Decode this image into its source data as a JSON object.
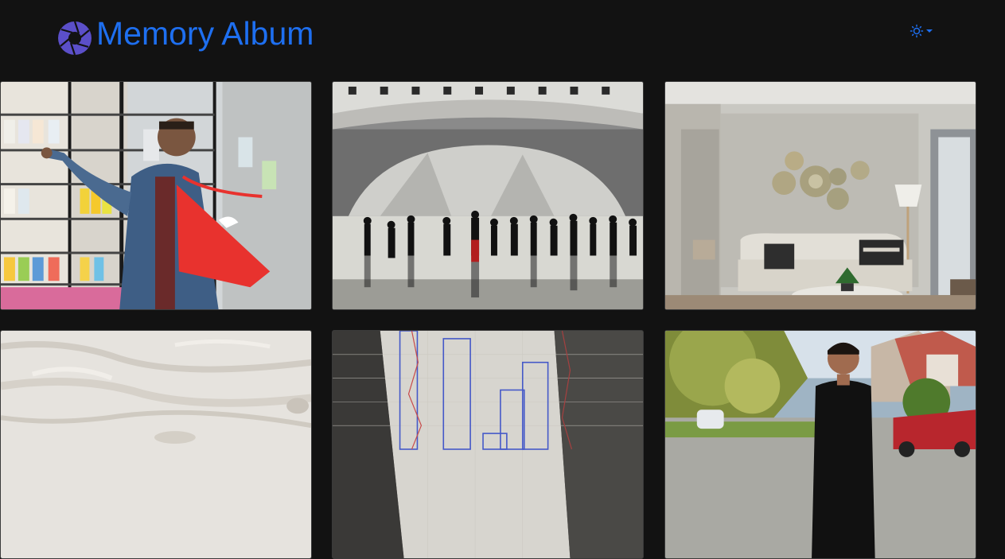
{
  "app": {
    "title": "Memory Album",
    "brand_color": "#1e6ff0",
    "logo_icon": "camera-aperture-icon",
    "theme_icon": "sun-icon"
  },
  "photos": [
    {
      "subject": "grocery-shopper"
    },
    {
      "subject": "rotunda-crowd"
    },
    {
      "subject": "living-room"
    },
    {
      "subject": "sand-dunes"
    },
    {
      "subject": "skyline-paper"
    },
    {
      "subject": "man-on-street"
    }
  ]
}
